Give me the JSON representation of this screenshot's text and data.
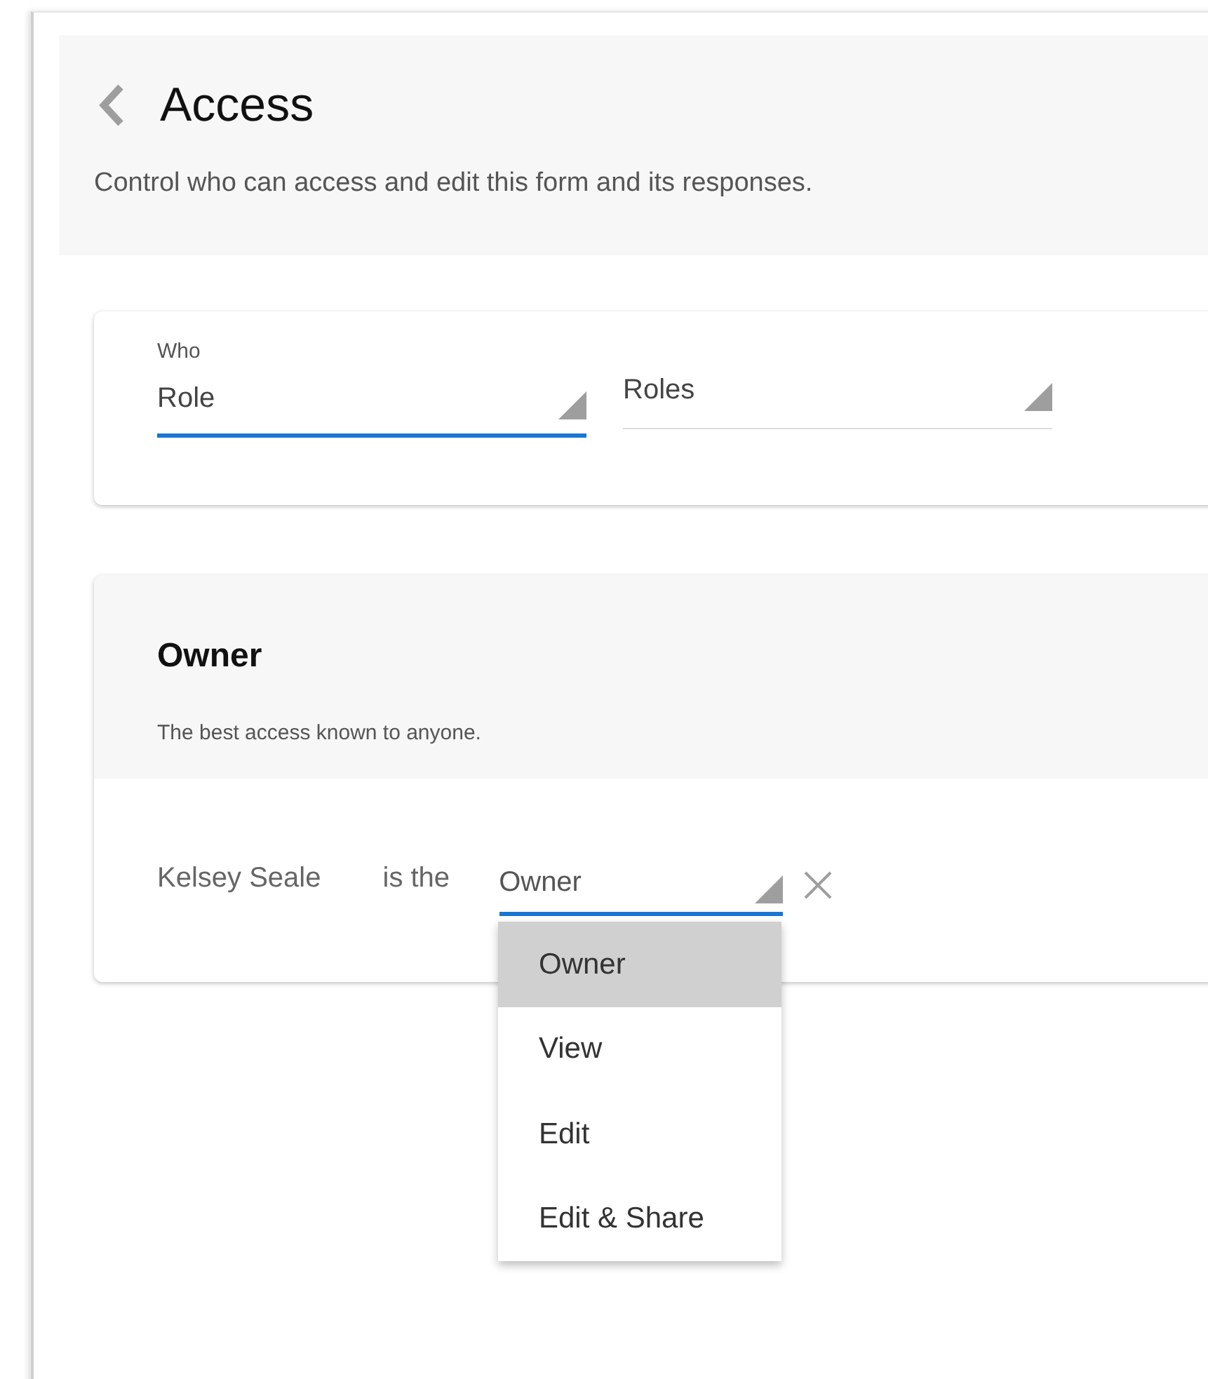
{
  "header": {
    "title": "Access",
    "description": "Control who can access and edit this form and its responses."
  },
  "who": {
    "label": "Who",
    "fields": [
      {
        "value": "Role",
        "focused": true
      },
      {
        "value": "Roles",
        "focused": false
      }
    ]
  },
  "access_group": {
    "title": "Owner",
    "description": "The best access known to anyone.",
    "member": {
      "name": "Kelsey Seale",
      "connector": "is the",
      "role": {
        "value": "Owner",
        "focused": true,
        "expanded": true
      }
    },
    "options": [
      {
        "label": "Owner",
        "selected": true
      },
      {
        "label": "View",
        "selected": false
      },
      {
        "label": "Edit",
        "selected": false
      },
      {
        "label": "Edit & Share",
        "selected": false
      }
    ]
  }
}
